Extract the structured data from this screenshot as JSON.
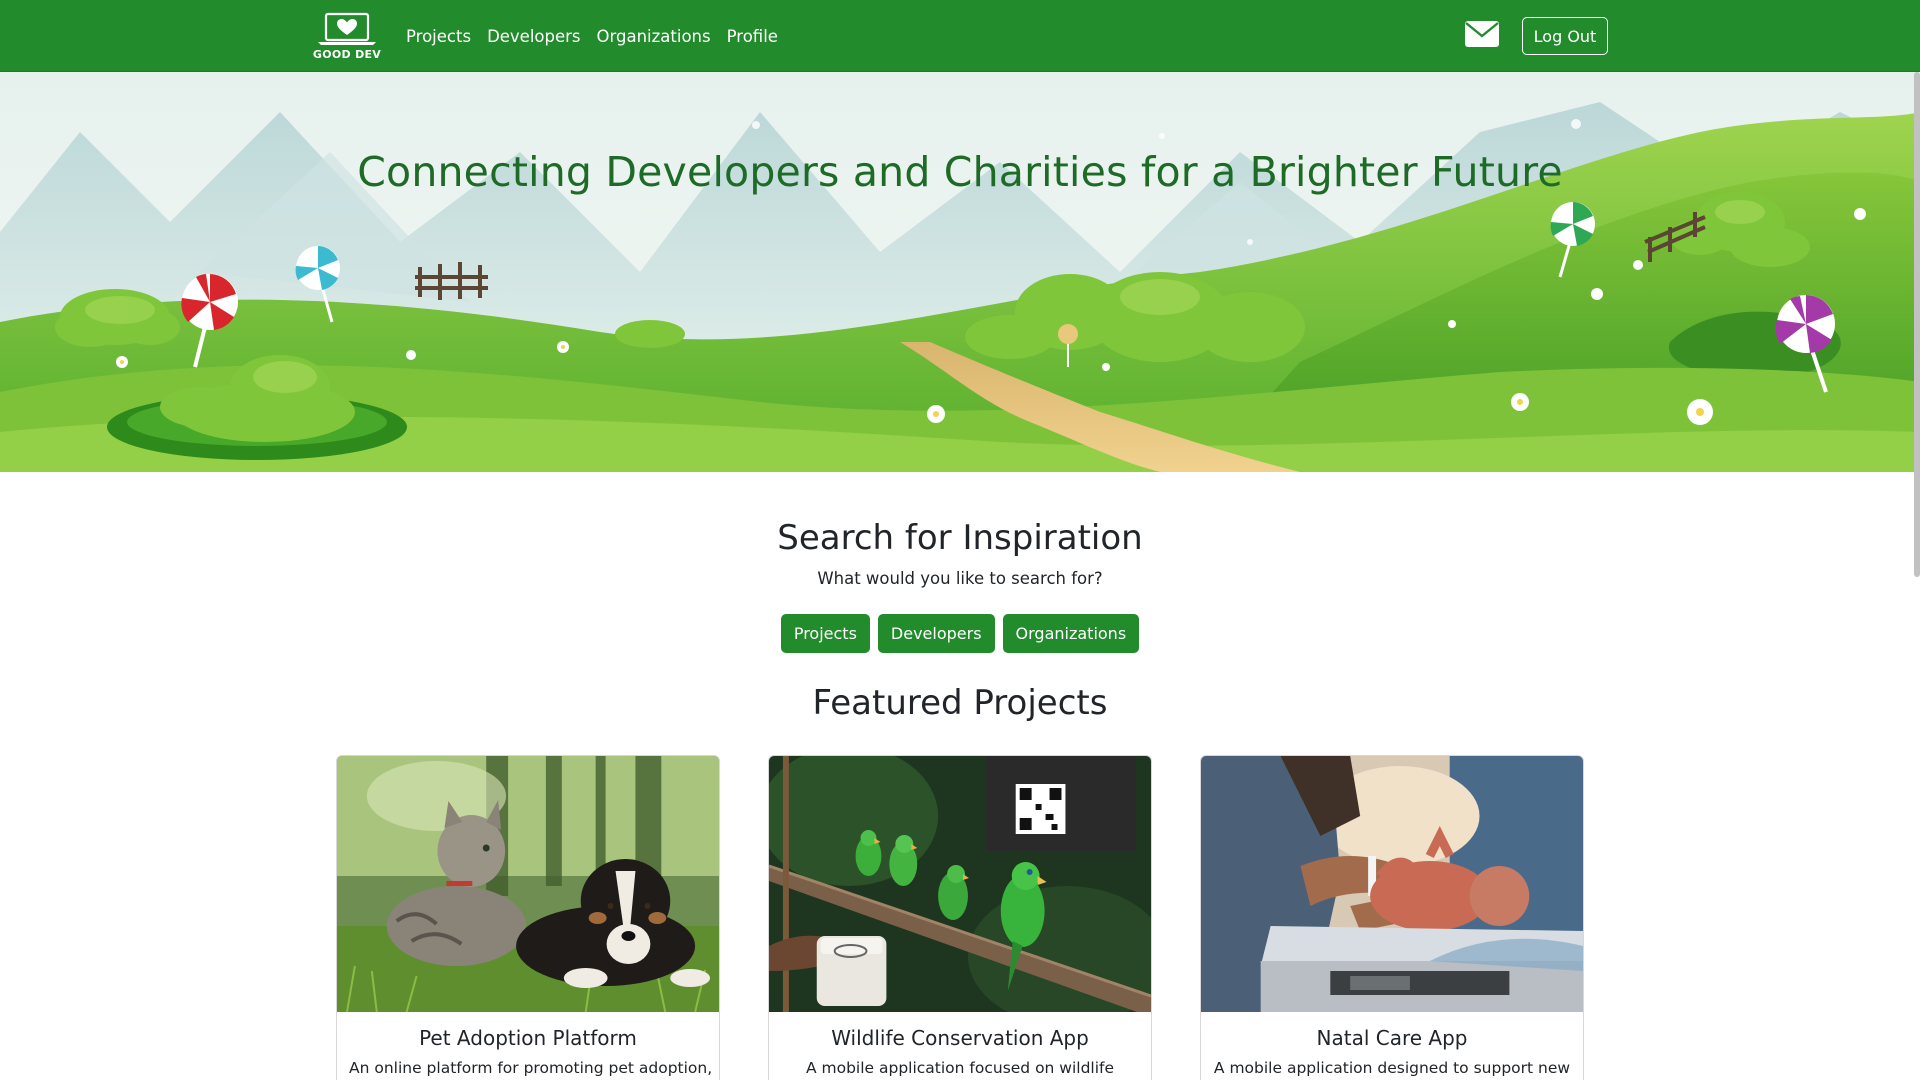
{
  "navbar": {
    "brand": "GOOD DEV",
    "links": [
      "Projects",
      "Developers",
      "Organizations",
      "Profile"
    ],
    "logout_label": "Log Out",
    "color": "#228b2c"
  },
  "hero": {
    "title": "Connecting Developers and Charities for a Brighter Future"
  },
  "search": {
    "title": "Search for Inspiration",
    "subtitle": "What would you like to search for?",
    "buttons": [
      "Projects",
      "Developers",
      "Organizations"
    ]
  },
  "featured": {
    "title": "Featured Projects",
    "cards": [
      {
        "title": "Pet Adoption Platform",
        "desc": "An online platform for promoting pet adoption,"
      },
      {
        "title": "Wildlife Conservation App",
        "desc": "A mobile application focused on wildlife"
      },
      {
        "title": "Natal Care App",
        "desc": "A mobile application designed to support new"
      }
    ]
  }
}
